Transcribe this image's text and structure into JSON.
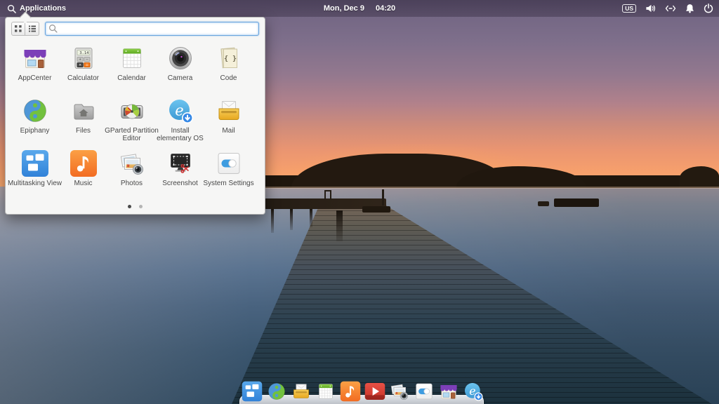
{
  "panel": {
    "applications_label": "Applications",
    "date": "Mon, Dec 9",
    "time": "04:20",
    "keyboard_layout": "US",
    "status_icons": [
      "volume-icon",
      "network-icon",
      "notifications-icon",
      "power-icon"
    ]
  },
  "launcher": {
    "search_placeholder": "",
    "search_value": "",
    "view_modes": [
      "grid-view",
      "list-view"
    ],
    "page_dots": {
      "total": 2,
      "active_index": 0
    },
    "apps": [
      {
        "label": "AppCenter",
        "icon": "appcenter"
      },
      {
        "label": "Calculator",
        "icon": "calculator"
      },
      {
        "label": "Calendar",
        "icon": "calendar"
      },
      {
        "label": "Camera",
        "icon": "camera"
      },
      {
        "label": "Code",
        "icon": "code"
      },
      {
        "label": "Epiphany",
        "icon": "epiphany"
      },
      {
        "label": "Files",
        "icon": "files"
      },
      {
        "label": "GParted Partition Editor",
        "icon": "gparted"
      },
      {
        "label": "Install elementary OS",
        "icon": "install-elementary"
      },
      {
        "label": "Mail",
        "icon": "mail"
      },
      {
        "label": "Multitasking View",
        "icon": "multitasking"
      },
      {
        "label": "Music",
        "icon": "music"
      },
      {
        "label": "Photos",
        "icon": "photos"
      },
      {
        "label": "Screenshot",
        "icon": "screenshot"
      },
      {
        "label": "System Settings",
        "icon": "settings"
      }
    ],
    "icon_art_text": {
      "calculator_display": "3.14",
      "code_glyph": "{ }",
      "install_glyph": "e"
    }
  },
  "dock": {
    "items": [
      {
        "icon": "multitasking"
      },
      {
        "icon": "epiphany"
      },
      {
        "icon": "mail"
      },
      {
        "icon": "calendar"
      },
      {
        "icon": "music"
      },
      {
        "icon": "videos"
      },
      {
        "icon": "photos"
      },
      {
        "icon": "settings"
      },
      {
        "icon": "appcenter"
      },
      {
        "icon": "install-elementary"
      }
    ]
  },
  "colors": {
    "accent_blue": "#3689e6",
    "awning_purple": "#7c3fb8",
    "music_orange": "#f37329",
    "mail_gold": "#e7a71f",
    "calendar_green": "#67b52b",
    "videos_red": "#c9372c",
    "panel_text": "#ffffff",
    "launcher_bg": "#f6f6f5"
  }
}
